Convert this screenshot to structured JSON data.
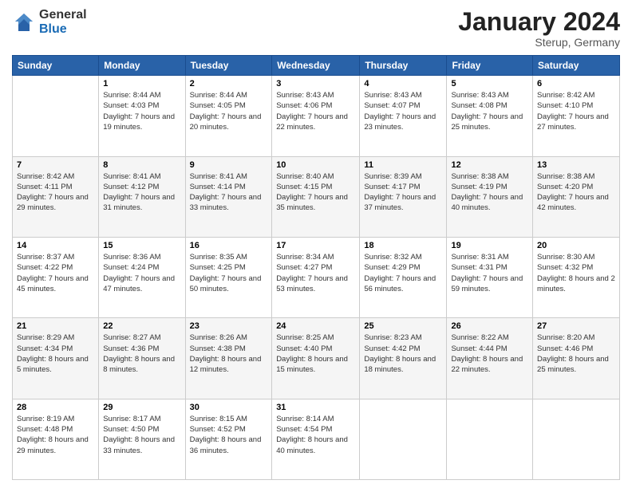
{
  "logo": {
    "general": "General",
    "blue": "Blue"
  },
  "header": {
    "title": "January 2024",
    "subtitle": "Sterup, Germany"
  },
  "days_of_week": [
    "Sunday",
    "Monday",
    "Tuesday",
    "Wednesday",
    "Thursday",
    "Friday",
    "Saturday"
  ],
  "weeks": [
    [
      {
        "day": "",
        "sunrise": "",
        "sunset": "",
        "daylight": ""
      },
      {
        "day": "1",
        "sunrise": "Sunrise: 8:44 AM",
        "sunset": "Sunset: 4:03 PM",
        "daylight": "Daylight: 7 hours and 19 minutes."
      },
      {
        "day": "2",
        "sunrise": "Sunrise: 8:44 AM",
        "sunset": "Sunset: 4:05 PM",
        "daylight": "Daylight: 7 hours and 20 minutes."
      },
      {
        "day": "3",
        "sunrise": "Sunrise: 8:43 AM",
        "sunset": "Sunset: 4:06 PM",
        "daylight": "Daylight: 7 hours and 22 minutes."
      },
      {
        "day": "4",
        "sunrise": "Sunrise: 8:43 AM",
        "sunset": "Sunset: 4:07 PM",
        "daylight": "Daylight: 7 hours and 23 minutes."
      },
      {
        "day": "5",
        "sunrise": "Sunrise: 8:43 AM",
        "sunset": "Sunset: 4:08 PM",
        "daylight": "Daylight: 7 hours and 25 minutes."
      },
      {
        "day": "6",
        "sunrise": "Sunrise: 8:42 AM",
        "sunset": "Sunset: 4:10 PM",
        "daylight": "Daylight: 7 hours and 27 minutes."
      }
    ],
    [
      {
        "day": "7",
        "sunrise": "Sunrise: 8:42 AM",
        "sunset": "Sunset: 4:11 PM",
        "daylight": "Daylight: 7 hours and 29 minutes."
      },
      {
        "day": "8",
        "sunrise": "Sunrise: 8:41 AM",
        "sunset": "Sunset: 4:12 PM",
        "daylight": "Daylight: 7 hours and 31 minutes."
      },
      {
        "day": "9",
        "sunrise": "Sunrise: 8:41 AM",
        "sunset": "Sunset: 4:14 PM",
        "daylight": "Daylight: 7 hours and 33 minutes."
      },
      {
        "day": "10",
        "sunrise": "Sunrise: 8:40 AM",
        "sunset": "Sunset: 4:15 PM",
        "daylight": "Daylight: 7 hours and 35 minutes."
      },
      {
        "day": "11",
        "sunrise": "Sunrise: 8:39 AM",
        "sunset": "Sunset: 4:17 PM",
        "daylight": "Daylight: 7 hours and 37 minutes."
      },
      {
        "day": "12",
        "sunrise": "Sunrise: 8:38 AM",
        "sunset": "Sunset: 4:19 PM",
        "daylight": "Daylight: 7 hours and 40 minutes."
      },
      {
        "day": "13",
        "sunrise": "Sunrise: 8:38 AM",
        "sunset": "Sunset: 4:20 PM",
        "daylight": "Daylight: 7 hours and 42 minutes."
      }
    ],
    [
      {
        "day": "14",
        "sunrise": "Sunrise: 8:37 AM",
        "sunset": "Sunset: 4:22 PM",
        "daylight": "Daylight: 7 hours and 45 minutes."
      },
      {
        "day": "15",
        "sunrise": "Sunrise: 8:36 AM",
        "sunset": "Sunset: 4:24 PM",
        "daylight": "Daylight: 7 hours and 47 minutes."
      },
      {
        "day": "16",
        "sunrise": "Sunrise: 8:35 AM",
        "sunset": "Sunset: 4:25 PM",
        "daylight": "Daylight: 7 hours and 50 minutes."
      },
      {
        "day": "17",
        "sunrise": "Sunrise: 8:34 AM",
        "sunset": "Sunset: 4:27 PM",
        "daylight": "Daylight: 7 hours and 53 minutes."
      },
      {
        "day": "18",
        "sunrise": "Sunrise: 8:32 AM",
        "sunset": "Sunset: 4:29 PM",
        "daylight": "Daylight: 7 hours and 56 minutes."
      },
      {
        "day": "19",
        "sunrise": "Sunrise: 8:31 AM",
        "sunset": "Sunset: 4:31 PM",
        "daylight": "Daylight: 7 hours and 59 minutes."
      },
      {
        "day": "20",
        "sunrise": "Sunrise: 8:30 AM",
        "sunset": "Sunset: 4:32 PM",
        "daylight": "Daylight: 8 hours and 2 minutes."
      }
    ],
    [
      {
        "day": "21",
        "sunrise": "Sunrise: 8:29 AM",
        "sunset": "Sunset: 4:34 PM",
        "daylight": "Daylight: 8 hours and 5 minutes."
      },
      {
        "day": "22",
        "sunrise": "Sunrise: 8:27 AM",
        "sunset": "Sunset: 4:36 PM",
        "daylight": "Daylight: 8 hours and 8 minutes."
      },
      {
        "day": "23",
        "sunrise": "Sunrise: 8:26 AM",
        "sunset": "Sunset: 4:38 PM",
        "daylight": "Daylight: 8 hours and 12 minutes."
      },
      {
        "day": "24",
        "sunrise": "Sunrise: 8:25 AM",
        "sunset": "Sunset: 4:40 PM",
        "daylight": "Daylight: 8 hours and 15 minutes."
      },
      {
        "day": "25",
        "sunrise": "Sunrise: 8:23 AM",
        "sunset": "Sunset: 4:42 PM",
        "daylight": "Daylight: 8 hours and 18 minutes."
      },
      {
        "day": "26",
        "sunrise": "Sunrise: 8:22 AM",
        "sunset": "Sunset: 4:44 PM",
        "daylight": "Daylight: 8 hours and 22 minutes."
      },
      {
        "day": "27",
        "sunrise": "Sunrise: 8:20 AM",
        "sunset": "Sunset: 4:46 PM",
        "daylight": "Daylight: 8 hours and 25 minutes."
      }
    ],
    [
      {
        "day": "28",
        "sunrise": "Sunrise: 8:19 AM",
        "sunset": "Sunset: 4:48 PM",
        "daylight": "Daylight: 8 hours and 29 minutes."
      },
      {
        "day": "29",
        "sunrise": "Sunrise: 8:17 AM",
        "sunset": "Sunset: 4:50 PM",
        "daylight": "Daylight: 8 hours and 33 minutes."
      },
      {
        "day": "30",
        "sunrise": "Sunrise: 8:15 AM",
        "sunset": "Sunset: 4:52 PM",
        "daylight": "Daylight: 8 hours and 36 minutes."
      },
      {
        "day": "31",
        "sunrise": "Sunrise: 8:14 AM",
        "sunset": "Sunset: 4:54 PM",
        "daylight": "Daylight: 8 hours and 40 minutes."
      },
      {
        "day": "",
        "sunrise": "",
        "sunset": "",
        "daylight": ""
      },
      {
        "day": "",
        "sunrise": "",
        "sunset": "",
        "daylight": ""
      },
      {
        "day": "",
        "sunrise": "",
        "sunset": "",
        "daylight": ""
      }
    ]
  ]
}
